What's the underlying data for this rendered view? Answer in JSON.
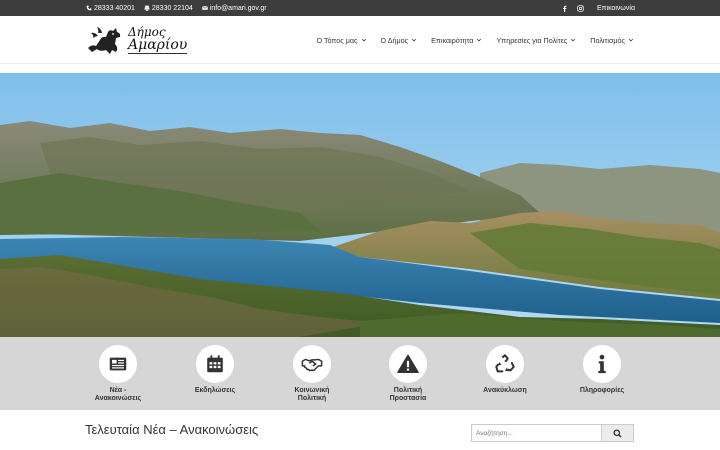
{
  "topbar": {
    "phone1": "28333 40201",
    "phone2": "28330 22104",
    "email": "info@amari.gov.gr",
    "contact_link": "Επικοινωνία",
    "social": [
      "facebook-icon",
      "instagram-icon"
    ]
  },
  "header": {
    "logo": {
      "line1": "Δήμος",
      "line2": "Αμαρίου"
    },
    "nav": [
      {
        "label": "Ο Τόπος μας"
      },
      {
        "label": "Ο Δήμος"
      },
      {
        "label": "Επικαιρότητα"
      },
      {
        "label": "Υπηρεσίες για Πολίτες"
      },
      {
        "label": "Πολιτισμός"
      }
    ]
  },
  "services": [
    {
      "line1": "Νέα -",
      "line2": "Ανακοινώσεις",
      "icon": "newspaper-icon"
    },
    {
      "line1": "Εκδηλώσεις",
      "line2": "",
      "icon": "calendar-icon"
    },
    {
      "line1": "Κοινωνική",
      "line2": "Πολιτική",
      "icon": "handshake-icon"
    },
    {
      "line1": "Πολιτική",
      "line2": "Προστασία",
      "icon": "warning-icon"
    },
    {
      "line1": "Ανακύκλωση",
      "line2": "",
      "icon": "recycle-icon"
    },
    {
      "line1": "Πληροφορίες",
      "line2": "",
      "icon": "info-icon"
    }
  ],
  "news": {
    "title": "Τελευταία Νέα – Ανακοινώσεις"
  },
  "search": {
    "placeholder": "Αναζήτηση..."
  },
  "colors": {
    "topbar": "#3d3d3d",
    "services_bg": "#d6d6d6",
    "sky": "#8ec6ea",
    "lake": "#2f6f9a"
  }
}
